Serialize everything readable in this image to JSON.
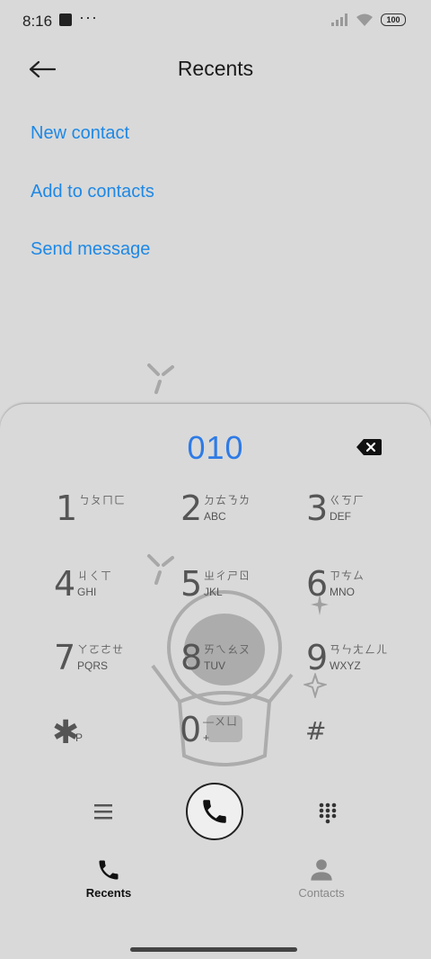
{
  "status_bar": {
    "time": "8:16",
    "more": "···",
    "battery": "100"
  },
  "header": {
    "title": "Recents"
  },
  "actions": [
    {
      "label": "New contact"
    },
    {
      "label": "Add to contacts"
    },
    {
      "label": "Send message"
    }
  ],
  "dialer": {
    "number": "010",
    "keys": [
      {
        "digit": "1",
        "zhuyin": "ㄅㄆㄇㄈ",
        "letters": ""
      },
      {
        "digit": "2",
        "zhuyin": "ㄉㄊㄋㄌ",
        "letters": "ABC"
      },
      {
        "digit": "3",
        "zhuyin": "ㄍㄎㄏ",
        "letters": "DEF"
      },
      {
        "digit": "4",
        "zhuyin": "ㄐㄑㄒ",
        "letters": "GHI"
      },
      {
        "digit": "5",
        "zhuyin": "ㄓㄔㄕㄖ",
        "letters": "JKL"
      },
      {
        "digit": "6",
        "zhuyin": "ㄗㄘㄙ",
        "letters": "MNO"
      },
      {
        "digit": "7",
        "zhuyin": "ㄚㄛㄜㄝ",
        "letters": "PQRS"
      },
      {
        "digit": "8",
        "zhuyin": "ㄞㄟㄠㄡ",
        "letters": "TUV"
      },
      {
        "digit": "9",
        "zhuyin": "ㄢㄣㄤㄥㄦ",
        "letters": "WXYZ"
      },
      {
        "digit": "✱",
        "zhuyin": "",
        "letters": "P"
      },
      {
        "digit": "0",
        "zhuyin": "—ㄨㄩ",
        "letters": "+"
      },
      {
        "digit": "#",
        "zhuyin": "",
        "letters": ""
      }
    ]
  },
  "bottom_nav": [
    {
      "label": "Recents",
      "icon": "phone-icon",
      "active": true
    },
    {
      "label": "Contacts",
      "icon": "person-icon",
      "active": false
    }
  ],
  "colors": {
    "accent": "#2e7be6",
    "link": "#1e88e5",
    "background": "#d9d9d9"
  }
}
